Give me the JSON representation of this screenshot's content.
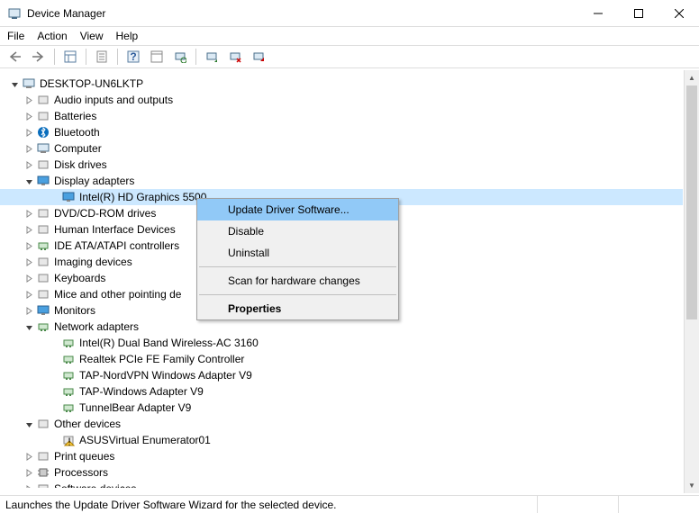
{
  "window": {
    "title": "Device Manager"
  },
  "menus": {
    "file": "File",
    "action": "Action",
    "view": "View",
    "help": "Help"
  },
  "tree": {
    "root": "DESKTOP-UN6LKTP",
    "items": [
      {
        "label": "Audio inputs and outputs",
        "exp": "›"
      },
      {
        "label": "Batteries",
        "exp": "›"
      },
      {
        "label": "Bluetooth",
        "exp": "›"
      },
      {
        "label": "Computer",
        "exp": "›"
      },
      {
        "label": "Disk drives",
        "exp": "›"
      },
      {
        "label": "Display adapters",
        "exp": "⌄",
        "children": [
          {
            "label": "Intel(R) HD Graphics 5500",
            "selected": true
          }
        ]
      },
      {
        "label": "DVD/CD-ROM drives",
        "exp": "›"
      },
      {
        "label": "Human Interface Devices",
        "exp": "›"
      },
      {
        "label": "IDE ATA/ATAPI controllers",
        "exp": "›"
      },
      {
        "label": "Imaging devices",
        "exp": "›"
      },
      {
        "label": "Keyboards",
        "exp": "›"
      },
      {
        "label": "Mice and other pointing devices",
        "exp": "›"
      },
      {
        "label": "Monitors",
        "exp": "›"
      },
      {
        "label": "Network adapters",
        "exp": "⌄",
        "children": [
          {
            "label": "Intel(R) Dual Band Wireless-AC 3160"
          },
          {
            "label": "Realtek PCIe FE Family Controller"
          },
          {
            "label": "TAP-NordVPN Windows Adapter V9"
          },
          {
            "label": "TAP-Windows Adapter V9"
          },
          {
            "label": "TunnelBear Adapter V9"
          }
        ]
      },
      {
        "label": "Other devices",
        "exp": "⌄",
        "children": [
          {
            "label": "ASUSVirtual Enumerator01"
          }
        ]
      },
      {
        "label": "Print queues",
        "exp": "›"
      },
      {
        "label": "Processors",
        "exp": "›"
      },
      {
        "label": "Software devices",
        "exp": "›"
      }
    ]
  },
  "context_menu": {
    "update": "Update Driver Software...",
    "disable": "Disable",
    "uninstall": "Uninstall",
    "scan": "Scan for hardware changes",
    "properties": "Properties"
  },
  "status": "Launches the Update Driver Software Wizard for the selected device."
}
